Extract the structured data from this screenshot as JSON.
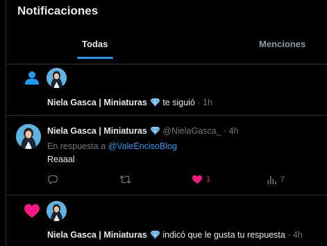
{
  "header": {
    "title": "Notificaciones",
    "tabs": [
      {
        "label": "Todas",
        "active": true
      },
      {
        "label": "Menciones",
        "active": false
      }
    ]
  },
  "colors": {
    "accent": "#1d9bf0",
    "like": "#f91880",
    "muted": "#71767b",
    "verified_badge": "#8ecdf7"
  },
  "notifications": [
    {
      "kind": "follow",
      "icon": "person-icon",
      "user": "Niela Gasca | Miniaturas",
      "badge_icon": "diamond-badge-icon",
      "action": "te siguió",
      "time": "· 1h"
    },
    {
      "kind": "reply",
      "user": "Niela Gasca | Miniaturas",
      "badge_icon": "diamond-badge-icon",
      "handle": "@NielaGasca_",
      "time": "· 4h",
      "reply_prefix": "En respuesta a",
      "reply_to": "@ValeEncisoBlog",
      "text": "Reaaal",
      "actions": {
        "reply_icon": "reply-icon",
        "retweet_icon": "retweet-icon",
        "like_icon": "heart-filled-icon",
        "likes": "1",
        "views_icon": "views-icon",
        "views": "7"
      }
    },
    {
      "kind": "like",
      "icon": "heart-icon",
      "user": "Niela Gasca | Miniaturas",
      "badge_icon": "diamond-badge-icon",
      "action": "indicó que le gusta tu respuesta",
      "time": "· 4h"
    }
  ]
}
